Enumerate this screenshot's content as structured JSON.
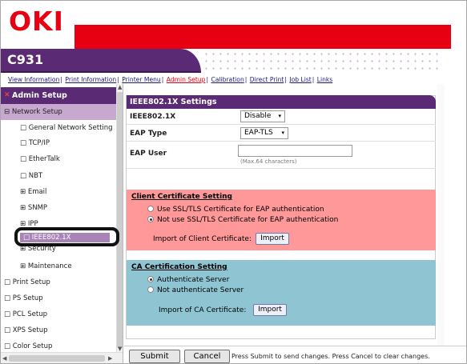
{
  "brand": {
    "logo": "OKI",
    "model": "C931"
  },
  "topnav": [
    {
      "label": "View Information"
    },
    {
      "label": "Print Information"
    },
    {
      "label": "Printer Menu"
    },
    {
      "label": "Admin Setup",
      "active": true
    },
    {
      "label": "Calibration"
    },
    {
      "label": "Direct Print"
    },
    {
      "label": "Job List"
    },
    {
      "label": "Links"
    }
  ],
  "sidebar": {
    "admin_label": "Admin Setup",
    "items": [
      {
        "label": "⊟ Network Setup"
      },
      {
        "label": "□ General Network Setting"
      },
      {
        "label": "□ TCP/IP"
      },
      {
        "label": "□ EtherTalk"
      },
      {
        "label": "□ NBT"
      },
      {
        "label": "⊞ Email"
      },
      {
        "label": "⊞ SNMP"
      },
      {
        "label": "⊞ IPP"
      },
      {
        "label": "□ IEEE802.1X"
      },
      {
        "label": "⊞ Security"
      },
      {
        "label": "⊞ Maintenance"
      },
      {
        "label": "□ Print Setup"
      },
      {
        "label": "□ PS Setup"
      },
      {
        "label": "□ PCL Setup"
      },
      {
        "label": "□ XPS Setup"
      },
      {
        "label": "□ Color Setup"
      }
    ],
    "scroll_arrows": {
      "up": "▲",
      "down": "▼",
      "left": "◀",
      "right": "▶"
    }
  },
  "main": {
    "section_title": "IEEE802.1X Settings",
    "fields": {
      "ieee_label": "IEEE802.1X",
      "ieee_value": "Disable",
      "eap_type_label": "EAP Type",
      "eap_type_value": "EAP-TLS",
      "eap_user_label": "EAP User",
      "eap_user_value": "",
      "eap_user_hint": "(Max.64 characters)"
    },
    "client_cert": {
      "title": "Client Certificate Setting",
      "option_use": "Use SSL/TLS Certificate for EAP authentication",
      "option_not_use": "Not use SSL/TLS Certificate for EAP authentication",
      "selected": "not_use",
      "import_label": "Import of Client Certificate:",
      "import_button": "Import"
    },
    "ca_cert": {
      "title": "CA Certification Setting",
      "option_auth": "Authenticate Server",
      "option_not_auth": "Not authenticate Server",
      "selected": "auth",
      "import_label": "Import of CA Certificate:",
      "import_button": "Import"
    },
    "caret": "▾"
  },
  "footer": {
    "submit": "Submit",
    "cancel": "Cancel",
    "message": "Press Submit to send changes. Press Cancel to clear changes."
  },
  "colors": {
    "brand_red": "#e60012",
    "purple": "#5b2a75",
    "client_box": "#ff9999",
    "ca_box": "#8fc5d3"
  }
}
